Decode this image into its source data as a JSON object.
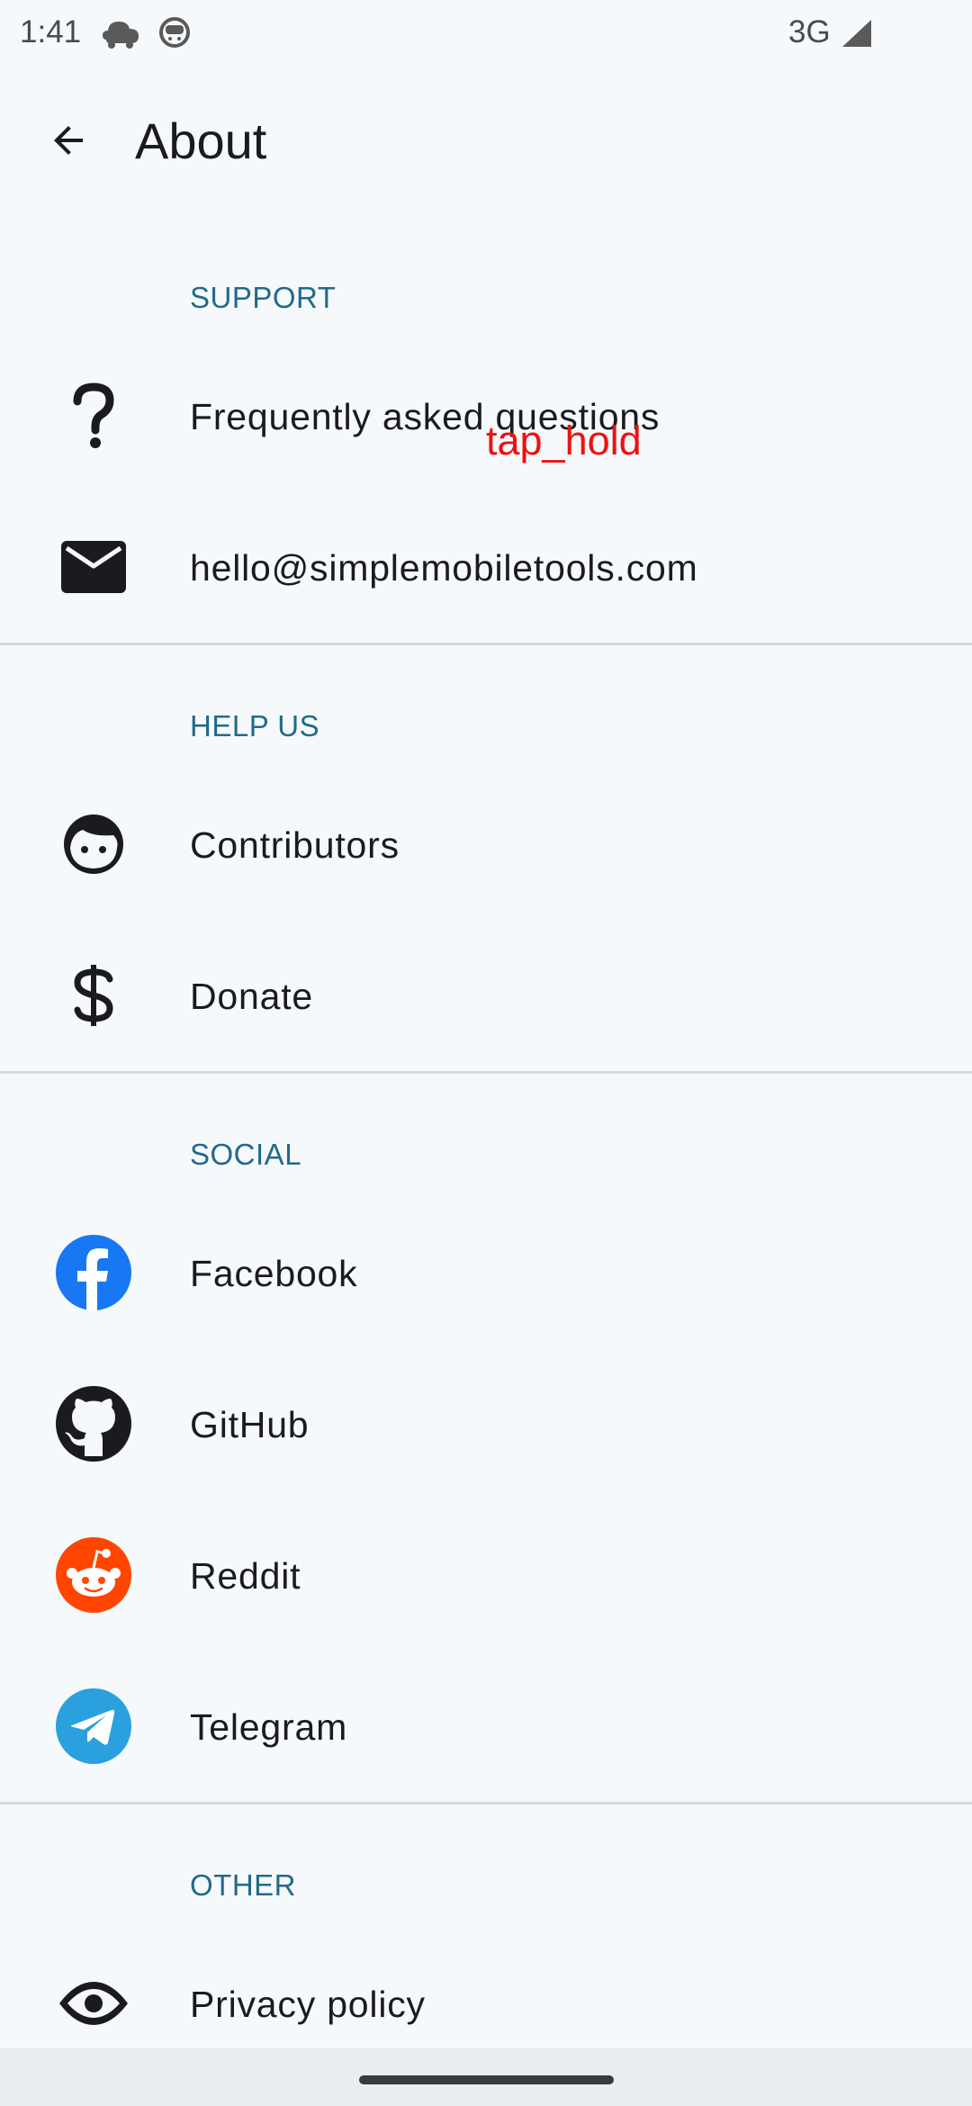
{
  "status_bar": {
    "time": "1:41",
    "network": "3G"
  },
  "app_bar": {
    "title": "About",
    "back_icon": "arrow-back-icon"
  },
  "sections": {
    "support": {
      "header": "SUPPORT",
      "items": [
        {
          "label": "Frequently asked questions",
          "icon": "question-mark-icon"
        },
        {
          "label": "hello@simplemobiletools.com",
          "icon": "envelope-icon"
        }
      ]
    },
    "help_us": {
      "header": "HELP US",
      "items": [
        {
          "label": "Contributors",
          "icon": "face-icon"
        },
        {
          "label": "Donate",
          "icon": "dollar-icon"
        }
      ]
    },
    "social": {
      "header": "SOCIAL",
      "items": [
        {
          "label": "Facebook",
          "icon": "facebook-icon"
        },
        {
          "label": "GitHub",
          "icon": "github-icon"
        },
        {
          "label": "Reddit",
          "icon": "reddit-icon"
        },
        {
          "label": "Telegram",
          "icon": "telegram-icon"
        }
      ]
    },
    "other": {
      "header": "OTHER",
      "items": [
        {
          "label": "Privacy policy",
          "icon": "eye-icon"
        }
      ]
    }
  },
  "overlay": {
    "action_label": "tap_hold"
  },
  "colors": {
    "accent": "#226a8a",
    "facebook": "#1877f2",
    "reddit": "#ff4500",
    "telegram": "#2aa1de",
    "background": "#f6f9fc"
  }
}
